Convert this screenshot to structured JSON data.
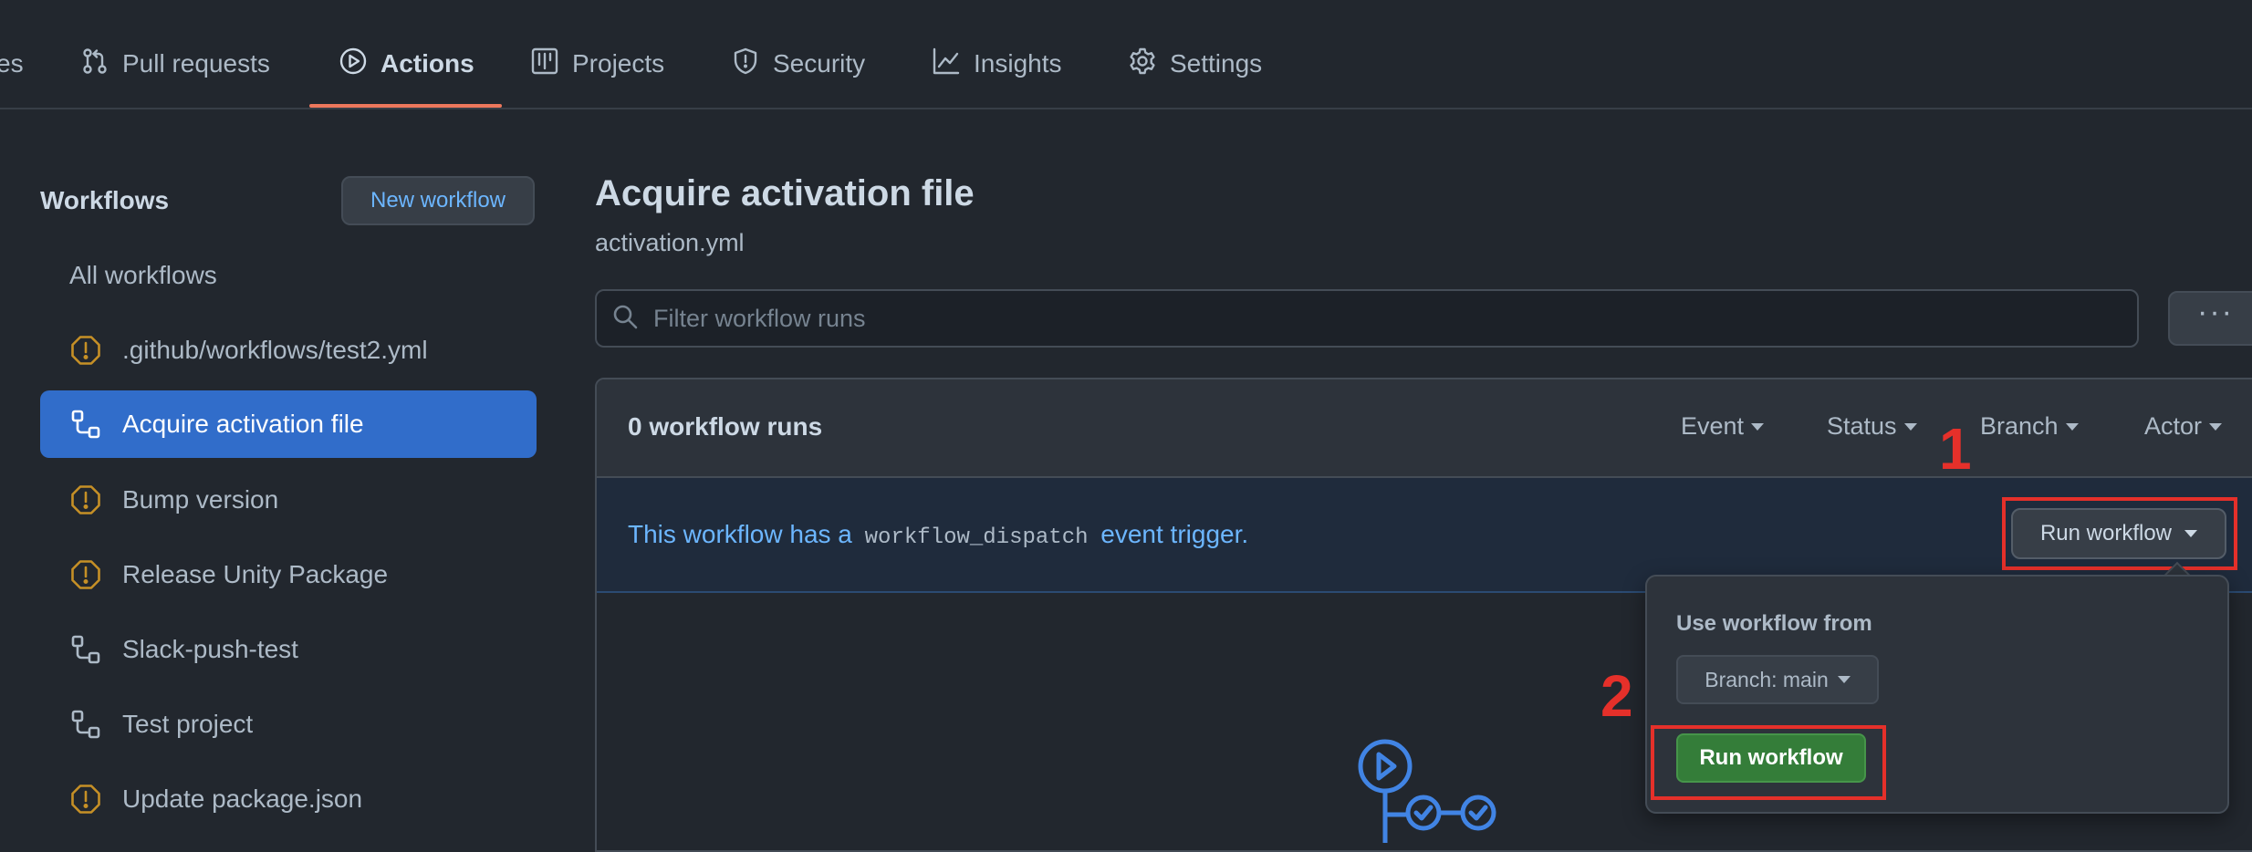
{
  "top_nav": {
    "tabs": [
      {
        "label": "es"
      },
      {
        "label": "Pull requests"
      },
      {
        "label": "Actions"
      },
      {
        "label": "Projects"
      },
      {
        "label": "Security"
      },
      {
        "label": "Insights"
      },
      {
        "label": "Settings"
      }
    ],
    "active_tab": "Actions"
  },
  "sidebar": {
    "heading": "Workflows",
    "new_workflow_label": "New workflow",
    "items": [
      {
        "label": "All workflows",
        "icon": "none"
      },
      {
        "label": ".github/workflows/test2.yml",
        "icon": "alert-icon"
      },
      {
        "label": "Acquire activation file",
        "icon": "workflow-icon",
        "selected": true
      },
      {
        "label": "Bump version",
        "icon": "alert-icon"
      },
      {
        "label": "Release Unity Package",
        "icon": "alert-icon"
      },
      {
        "label": "Slack-push-test",
        "icon": "workflow-icon"
      },
      {
        "label": "Test project",
        "icon": "workflow-icon"
      },
      {
        "label": "Update package.json",
        "icon": "alert-icon"
      }
    ]
  },
  "main": {
    "title": "Acquire activation file",
    "filename": "activation.yml",
    "filter": {
      "placeholder": "Filter workflow runs",
      "value": ""
    },
    "more_label": "···",
    "runs": {
      "count_label": "0 workflow runs",
      "filters": [
        "Event",
        "Status",
        "Branch",
        "Actor"
      ]
    },
    "dispatch": {
      "text_before": "This workflow has a",
      "code": "workflow_dispatch",
      "text_after": "event trigger."
    },
    "run_workflow_label": "Run workflow",
    "popover": {
      "heading": "Use workflow from",
      "branch_label": "Branch: main",
      "run_button_label": "Run workflow"
    }
  },
  "annotations": {
    "marker_1": "1",
    "marker_2": "2",
    "highlight_color": "#e5302a"
  },
  "colors": {
    "background": "#22272e",
    "accent_blue": "#316dca",
    "link_blue": "#6cb6ff",
    "active_tab_underline": "#ec775c",
    "warning": "#c69026",
    "success_green": "#347d39"
  }
}
